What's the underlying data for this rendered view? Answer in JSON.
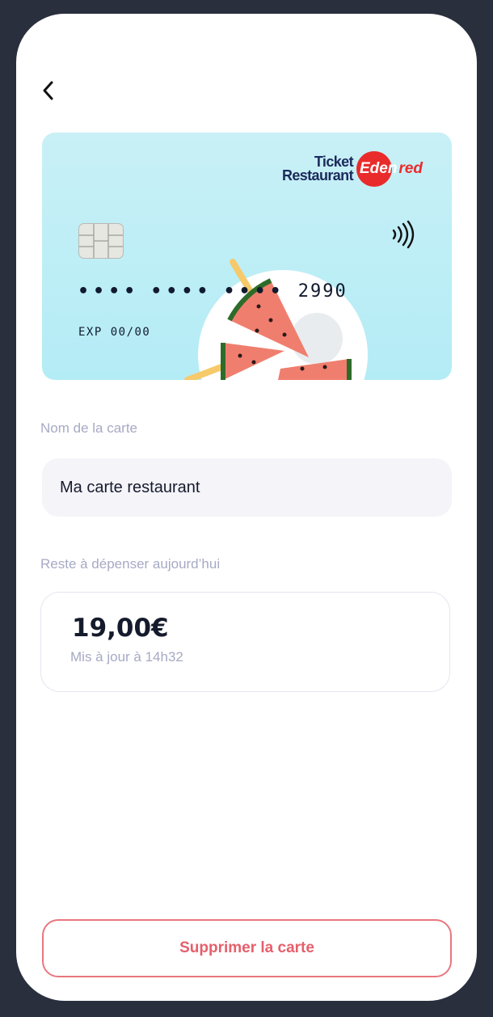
{
  "nav": {
    "back_icon": "chevron-left-icon"
  },
  "card": {
    "brand_line1": "Ticket",
    "brand_line2": "Restaurant",
    "brand_name_white": "Eden",
    "brand_name_red": "red",
    "masked_groups": [
      "••••",
      "••••",
      "••••"
    ],
    "last4": "2990",
    "expiry": "EXP 00/00",
    "colors": {
      "background": "#c8f0f6",
      "brand_navy": "#1c2a5c",
      "brand_red": "#ea2b2b"
    }
  },
  "card_name": {
    "label": "Nom de la carte",
    "value": "Ma carte restaurant"
  },
  "balance": {
    "label": "Reste à dépenser aujourd’hui",
    "amount": "19,00€",
    "updated": "Mis à jour à 14h32"
  },
  "actions": {
    "delete_label": "Supprimer la carte",
    "delete_color": "#e5606c"
  }
}
